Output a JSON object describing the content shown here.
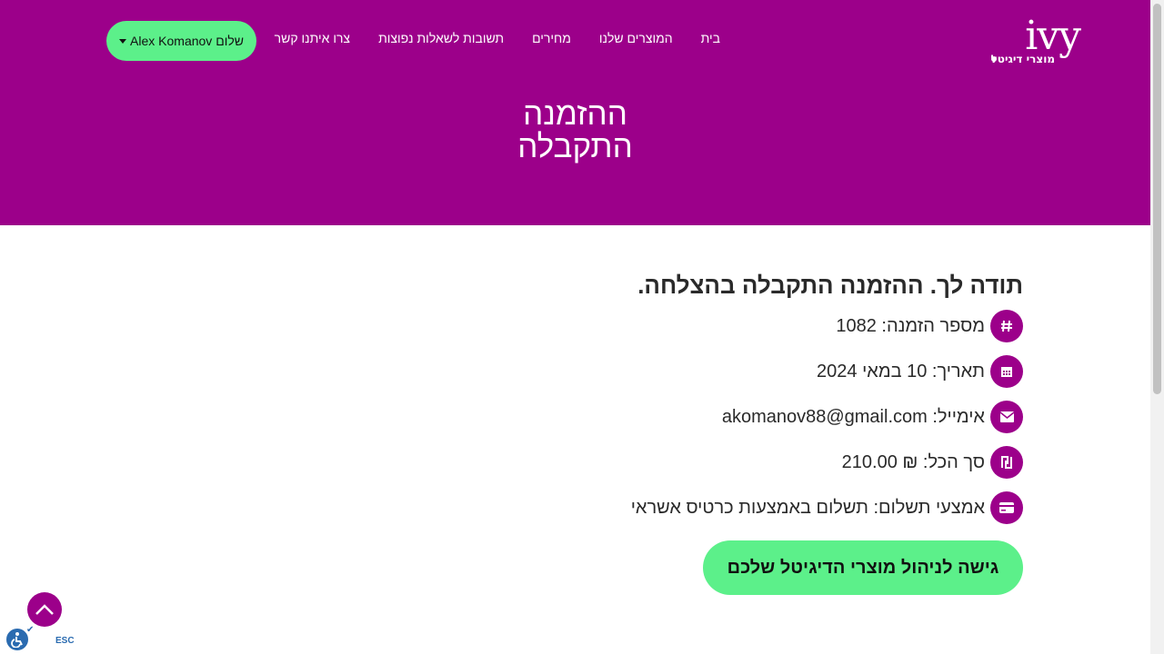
{
  "logo": {
    "mark": "ivy",
    "subtitle": "מוצרי דיגיטל"
  },
  "nav": {
    "links": [
      "בית",
      "המוצרים שלנו",
      "מחירים",
      "תשובות לשאלות נפוצות",
      "צרו איתנו קשר"
    ],
    "user_label": "שלום Alex Komanov"
  },
  "page": {
    "title_line1": "ההזמנה",
    "title_line2": "התקבלה"
  },
  "order": {
    "thanks": "תודה לך. ההזמנה התקבלה בהצלחה.",
    "number": "מספר הזמנה: 1082",
    "date": "תאריך: 10 במאי 2024",
    "email": "אימייל: akomanov88@gmail.com",
    "total": "סך הכל: ₪ 210.00",
    "payment": "אמצעי תשלום: תשלום באמצעות כרטיס אשראי"
  },
  "cta_label": "גישה לניהול מוצרי הדיגיטל שלכם",
  "accessibility": {
    "esc_label": "ESC"
  },
  "colors": {
    "brand": "#9c008a",
    "accent": "#5cf08a",
    "text": "#2a2a2a"
  }
}
